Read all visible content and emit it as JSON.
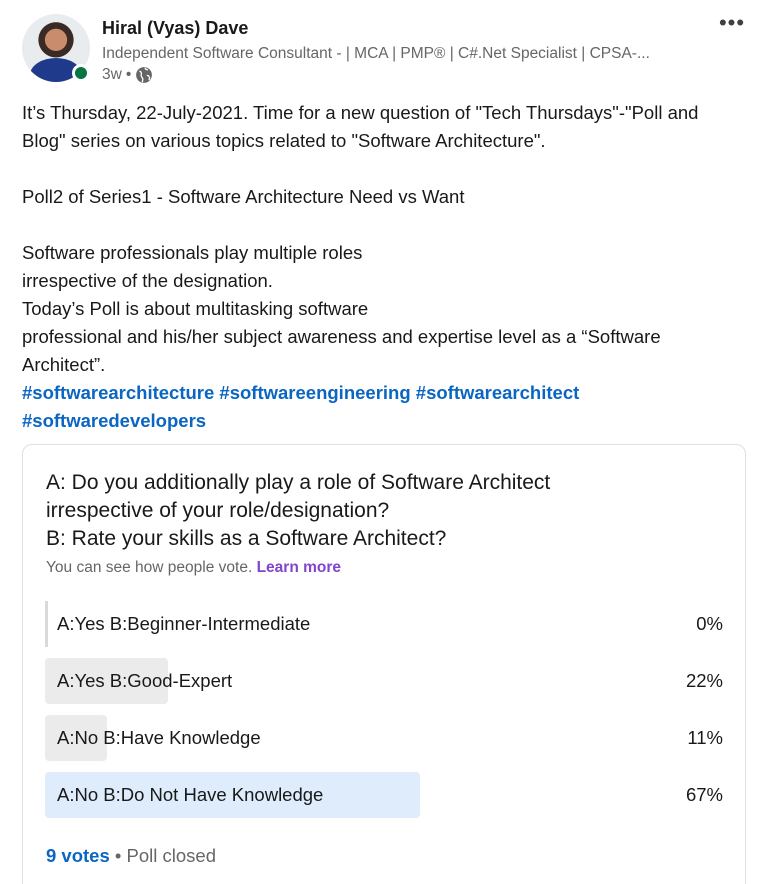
{
  "author": {
    "name": "Hiral (Vyas) Dave",
    "headline": "Independent Software Consultant - | MCA | PMP® | C#.Net Specialist | CPSA-...",
    "time": "3w",
    "separator": "•",
    "visibility_icon": "globe-icon",
    "status": "online",
    "status_color": "#057642"
  },
  "menu": {
    "more_label": "•••"
  },
  "post": {
    "lines": [
      "It’s Thursday, 22-July-2021. Time for a new question of \"Tech Thursdays\"-\"Poll and",
      "Blog\" series on various topics related to \"Software Architecture\".",
      "",
      "Poll2 of Series1 - Software Architecture Need vs Want",
      "",
      "Software professionals play multiple roles",
      "irrespective of the designation.",
      "Today’s Poll is about multitasking software",
      "professional and his/her subject awareness and expertise level as a “Software",
      "Architect”."
    ],
    "hashtags": [
      "#softwarearchitecture",
      "#softwareengineering",
      "#softwarearchitect",
      "#softwaredevelopers"
    ]
  },
  "poll": {
    "question_lines": [
      "A: Do you additionally play a role of Software Architect",
      "irrespective of your role/designation?",
      "B: Rate your skills as a Software Architect?"
    ],
    "note": "You can see how people vote.",
    "learn_more": "Learn more",
    "options": [
      {
        "label": "A:Yes B:Beginner-Intermediate",
        "percent_label": "0%",
        "percent": 0
      },
      {
        "label": "A:Yes B:Good-Expert",
        "percent_label": "22%",
        "percent": 22
      },
      {
        "label": "A:No B:Have Knowledge",
        "percent_label": "11%",
        "percent": 11
      },
      {
        "label": "A:No B:Do Not Have Knowledge",
        "percent_label": "67%",
        "percent": 67
      }
    ],
    "votes": "9 votes",
    "separator": "•",
    "status": "Poll closed"
  },
  "colors": {
    "link": "#0a66c2",
    "learn_more": "#8344cc",
    "bar": "#ebebeb",
    "winner_bar": "#dfecfb"
  }
}
